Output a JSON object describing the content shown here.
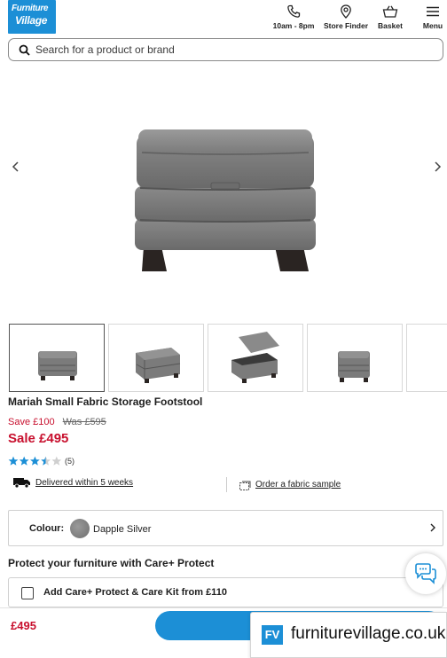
{
  "header": {
    "logo": {
      "line1": "Furniture",
      "line2": "Village"
    },
    "nav": [
      {
        "label": "10am - 8pm",
        "icon": "phone-icon"
      },
      {
        "label": "Store Finder",
        "icon": "location-pin-icon"
      },
      {
        "label": "Basket",
        "icon": "basket-icon"
      },
      {
        "label": "Menu",
        "icon": "hamburger-menu-icon"
      }
    ]
  },
  "search": {
    "placeholder": "Search for a product or brand"
  },
  "gallery": {
    "thumbnail_count": 5,
    "active_index": 0
  },
  "product": {
    "title": "Mariah Small Fabric Storage Footstool",
    "save_text": "Save £100",
    "was_text": "Was £595",
    "sale_text": "Sale £495",
    "rating": 3.5,
    "rating_max": 5,
    "review_count": "(5)",
    "delivery_text": "Delivered within 5 weeks",
    "sample_text": "Order a fabric sample"
  },
  "colour": {
    "label": "Colour:",
    "value": "Dapple Silver"
  },
  "protection": {
    "heading": "Protect your furniture with Care+ Protect",
    "option_label": "Add Care+ Protect & Care Kit from £110",
    "checked": false
  },
  "sticky_bar": {
    "price": "£495"
  },
  "badge": {
    "logo": "FV",
    "text": "furniturevillage.co.uk"
  },
  "colors": {
    "brand_blue": "#1c8fd6",
    "sale_red": "#c8102e",
    "star_blue": "#1c8fd6"
  }
}
